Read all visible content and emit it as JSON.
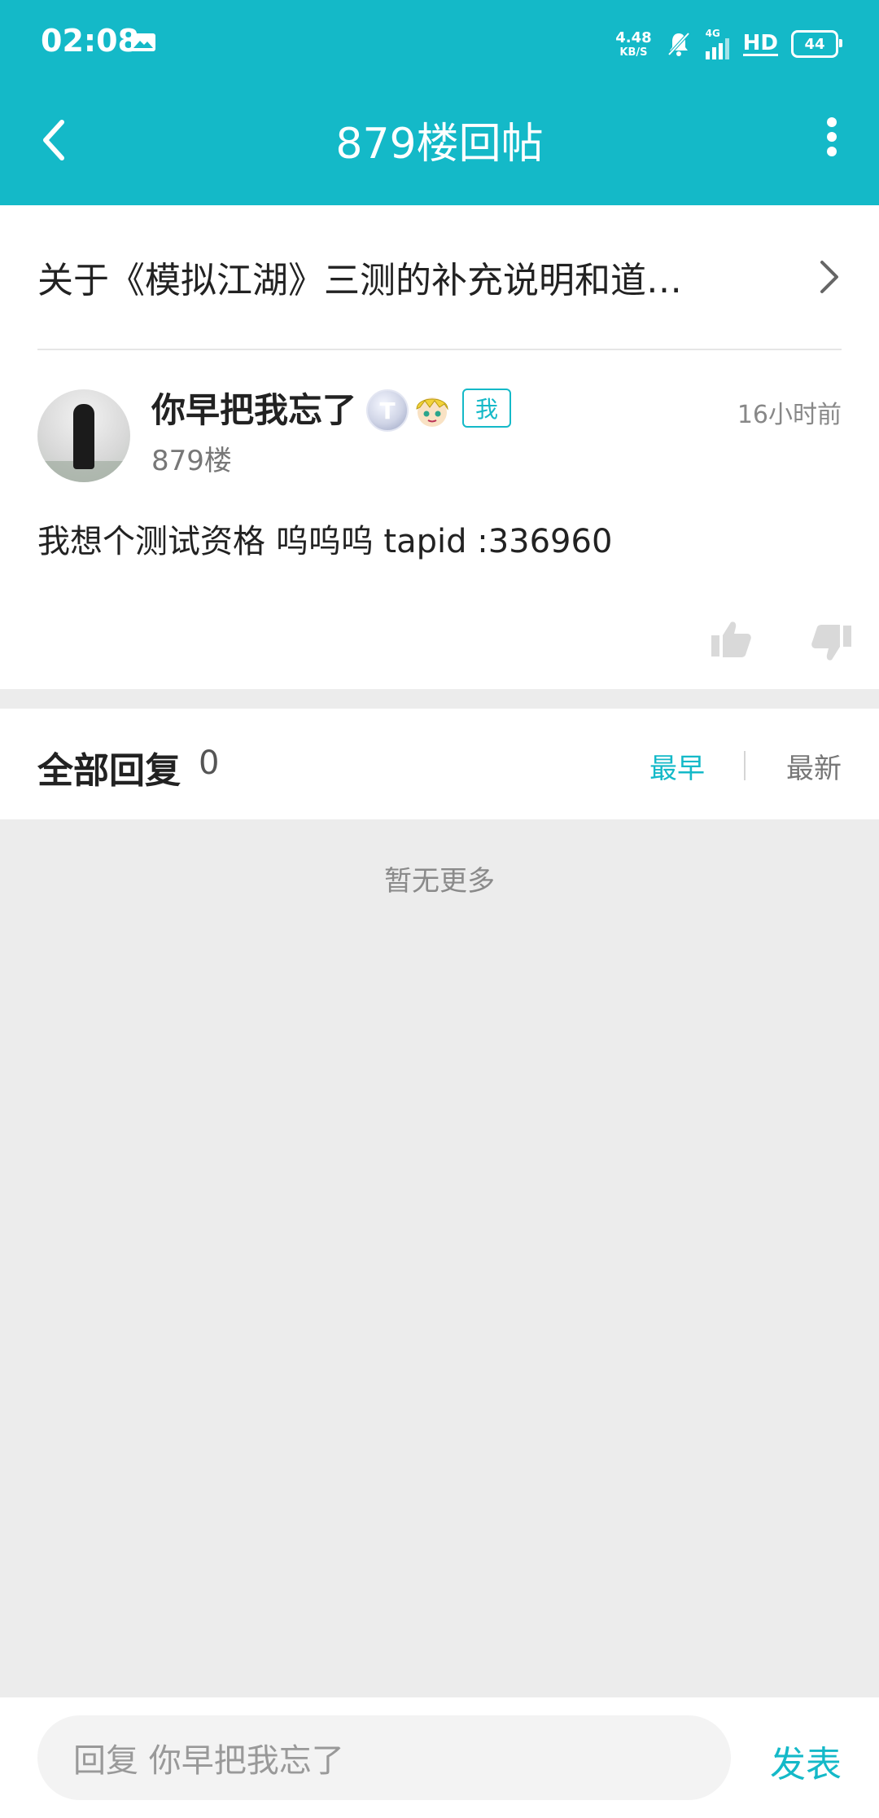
{
  "status_bar": {
    "time": "02:08",
    "net_speed_value": "4.48",
    "net_speed_unit": "KB/S",
    "network_label": "4G",
    "hd_label": "HD",
    "battery": "44"
  },
  "app_bar": {
    "title": "879楼回帖"
  },
  "post": {
    "thread_title": "关于《模拟江湖》三测的补充说明和道…",
    "username": "你早把我忘了",
    "badge_t": "T",
    "me_tag": "我",
    "floor": "879楼",
    "time_ago": "16小时前",
    "content": "我想个测试资格 呜呜呜   tapid :336960"
  },
  "replies": {
    "label": "全部回复",
    "count": "0",
    "sort_earliest": "最早",
    "sort_latest": "最新",
    "empty_text": "暂无更多"
  },
  "bottom_bar": {
    "reply_placeholder": "回复 你早把我忘了",
    "publish_label": "发表"
  },
  "colors": {
    "accent": "#14b9c8"
  }
}
